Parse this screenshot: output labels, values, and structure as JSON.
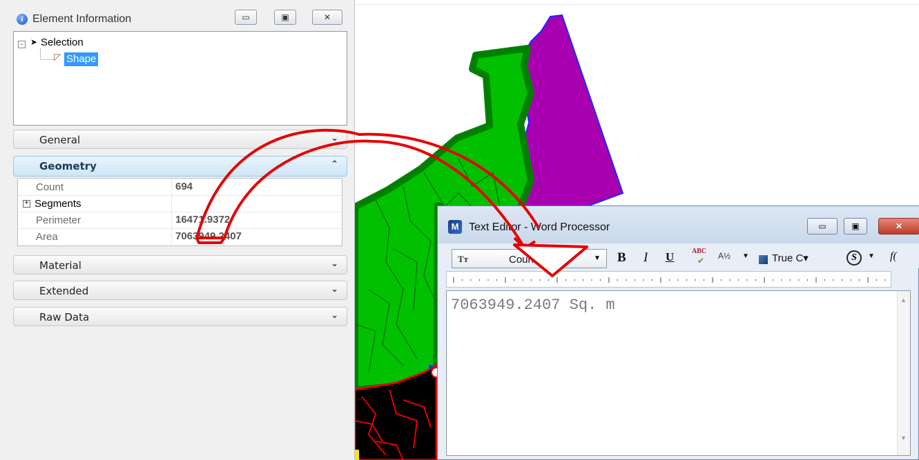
{
  "element_info": {
    "title": "Element Information",
    "buttons": {
      "minimize": "▭",
      "maximize": "▣",
      "close": "✕"
    },
    "tree": {
      "root_label": "Selection",
      "child_label": "Shape"
    },
    "sections": {
      "general": "General",
      "geometry": "Geometry",
      "material": "Material",
      "extended": "Extended",
      "raw_data": "Raw Data"
    },
    "geometry_rows": [
      {
        "label": "Count",
        "value": "694"
      },
      {
        "label": "Segments",
        "value": ""
      },
      {
        "label": "Perimeter",
        "value": "16471.9372"
      },
      {
        "label": "Area",
        "value": "7063949.2407"
      }
    ]
  },
  "text_editor": {
    "title": "Text Editor - Word Processor",
    "font_name": "Courier New",
    "tt_icon": "Tт",
    "bold": "B",
    "italic": "I",
    "underline": "U",
    "spell": "ABC",
    "fraction": "A½",
    "color_label": "True C",
    "style_icon": "S",
    "fx": "f(",
    "buttons": {
      "minimize": "▭",
      "maximize": "▣",
      "close": "✕"
    },
    "content": "7063949.2407 Sq. m"
  },
  "colors": {
    "green": "#00c000",
    "dark_green": "#008000",
    "purple": "#a800b0",
    "arrow_red": "#e60000",
    "selection_blue": "#3399ff"
  }
}
